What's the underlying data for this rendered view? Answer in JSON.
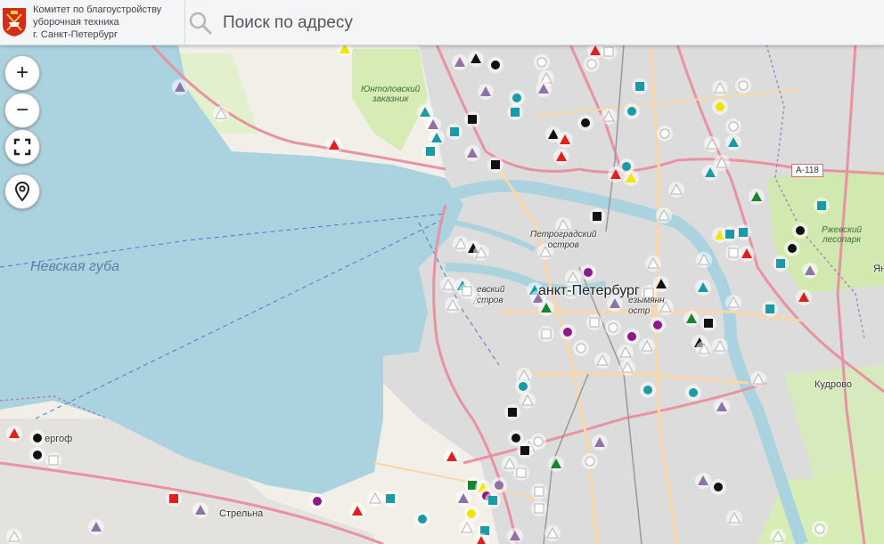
{
  "header": {
    "org_lines": [
      "Комитет по благоустройству",
      "уборочная техника",
      "г. Санкт-Петербург"
    ],
    "search_placeholder": "Поиск по адресу"
  },
  "controls": {
    "zoom_in": "+",
    "zoom_out": "−"
  },
  "labels": {
    "nevskaya_guba": "Невская губа",
    "yuntolovsky_1": "Юнтоловский",
    "yuntolovsky_2": "заказник",
    "petrogradsky_1": "Петроградский",
    "petrogradsky_2": "остров",
    "vasilyevsky_1": "евский",
    "vasilyevsky_2": "стров",
    "city": "анкт-Петербург",
    "bezymyanny_1": "езымянн",
    "bezymyanny_2": "остр",
    "rzhevsky_1": "Ржевский",
    "rzhevsky_2": "лесопарк",
    "kudrovo": "Кудрово",
    "strelna": "Стрельна",
    "petergof": "ергоф",
    "ya": "Ян",
    "road_a118": "А-118"
  },
  "colors": {
    "water": "#aad3df",
    "land": "#f2efe9",
    "urban": "#dddcdc",
    "green": "#cfeaa7",
    "road_major": "#e892a2",
    "road_secondary": "#fcd6a4",
    "marker_red": "#e31e1e",
    "marker_black": "#111111",
    "marker_teal": "#1a9ba6",
    "marker_yellow": "#f2e600",
    "marker_purple": "#8b1a8a",
    "marker_green": "#16852e",
    "marker_lavender": "#8f73a6",
    "marker_white": "#ffffff"
  },
  "markers": [
    {
      "type": "triangle",
      "color": "yellow"
    },
    {
      "type": "triangle",
      "color": "black"
    },
    {
      "type": "triangle",
      "color": "red"
    },
    {
      "type": "triangle",
      "color": "lavender"
    },
    {
      "type": "circle",
      "color": "black"
    },
    {
      "type": "square",
      "color": "teal"
    },
    {
      "type": "circle",
      "color": "teal"
    },
    {
      "type": "triangle",
      "color": "red"
    },
    {
      "type": "triangle",
      "color": "green"
    },
    {
      "type": "circle",
      "color": "purple"
    },
    {
      "type": "square",
      "color": "black"
    },
    {
      "type": "triangle",
      "color": "white"
    },
    {
      "type": "square",
      "color": "white"
    },
    {
      "type": "circle",
      "color": "white"
    }
  ]
}
